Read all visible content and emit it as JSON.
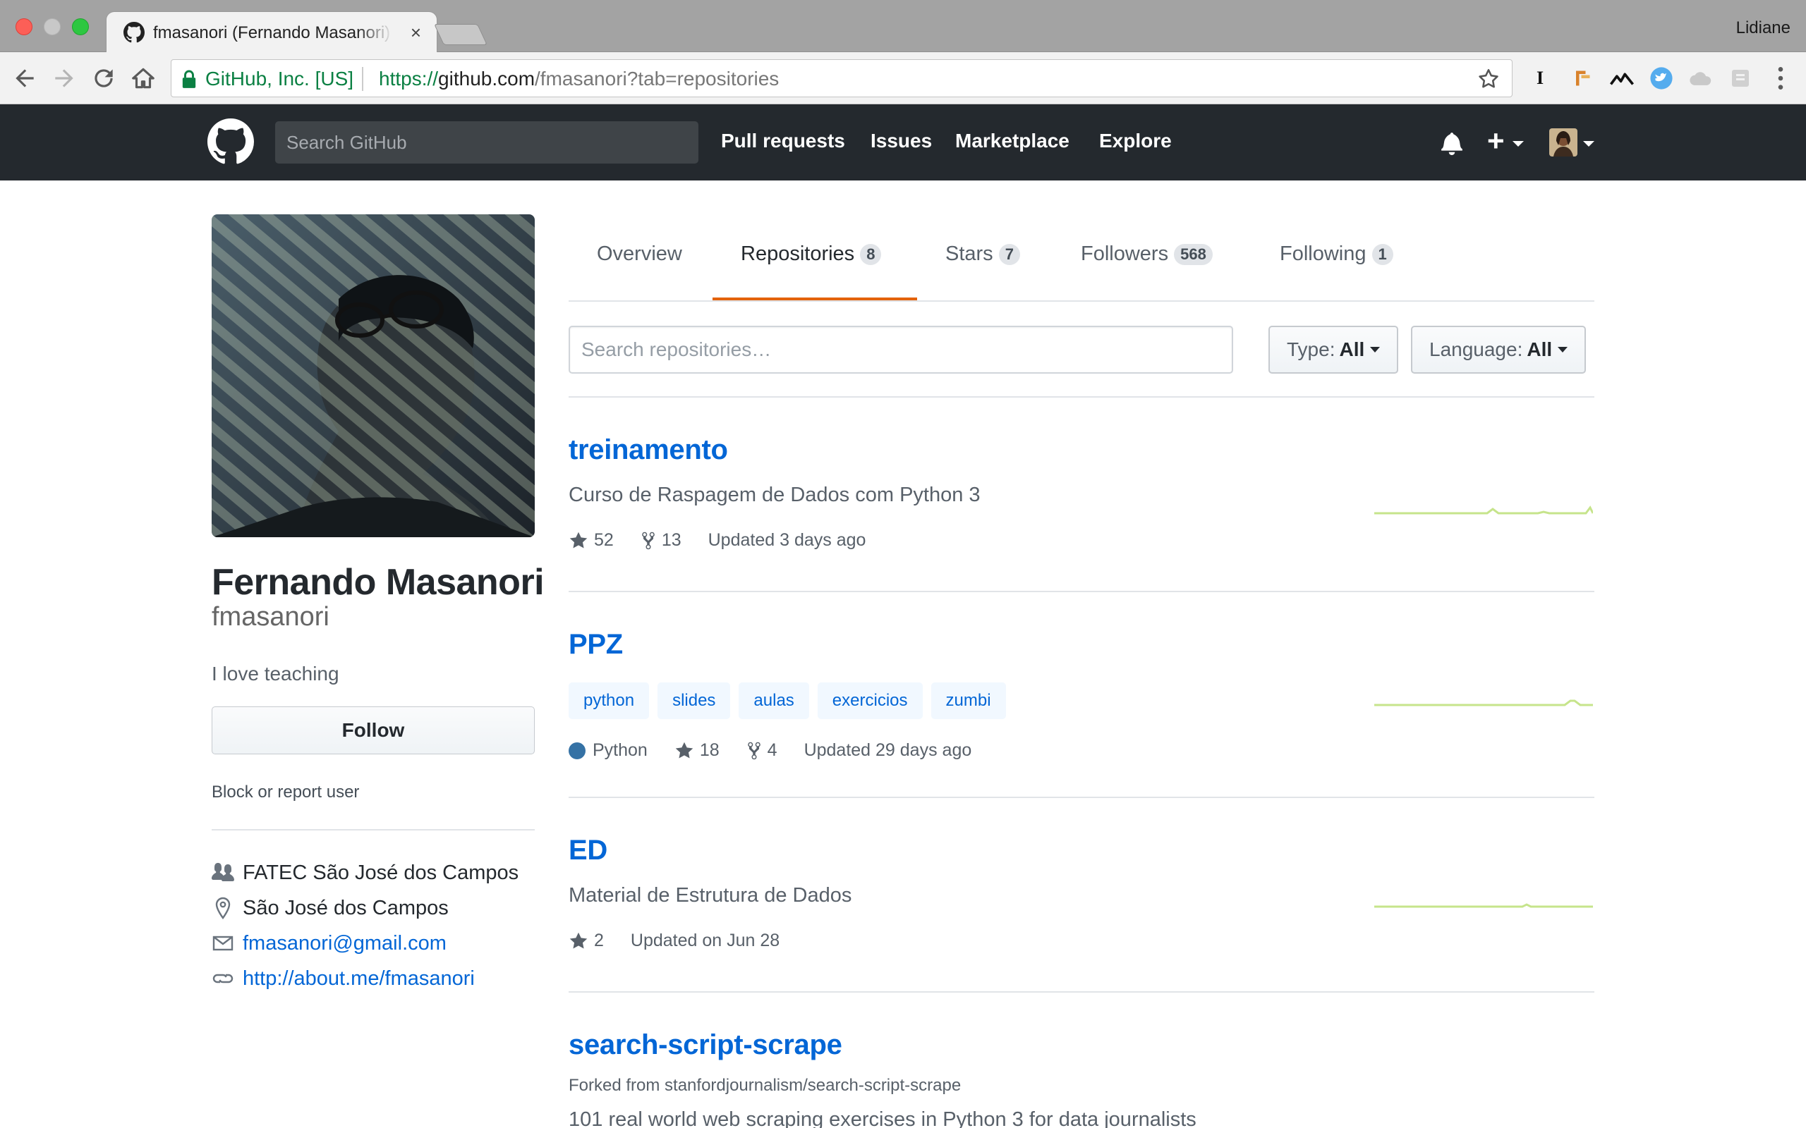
{
  "browser": {
    "tab_title": "fmasanori (Fernando Masanori)",
    "tab_close": "×",
    "profile_name": "Lidiane",
    "ev_label": "GitHub, Inc. [US]",
    "url_scheme": "https://",
    "url_host": "github.com",
    "url_path": "/fmasanori?tab=repositories",
    "extension_icons": [
      "instapaper-icon",
      "bookmark-ribbon-icon",
      "mountains-icon",
      "twitter-icon",
      "cloud-icon",
      "page-icon"
    ],
    "ext_instapaper_label": "I"
  },
  "github_header": {
    "search_placeholder": "Search GitHub",
    "nav": {
      "pull_requests": "Pull requests",
      "issues": "Issues",
      "marketplace": "Marketplace",
      "explore": "Explore"
    },
    "plus_label": "+"
  },
  "profile": {
    "full_name": "Fernando Masanori",
    "username": "fmasanori",
    "bio": "I love teaching",
    "follow_label": "Follow",
    "block_label": "Block or report user",
    "organization": "FATEC São José dos Campos",
    "location": "São José dos Campos",
    "email": "fmasanori@gmail.com",
    "website": "http://about.me/fmasanori"
  },
  "tabs": {
    "overview": "Overview",
    "repositories": "Repositories",
    "repositories_count": "8",
    "stars": "Stars",
    "stars_count": "7",
    "followers": "Followers",
    "followers_count": "568",
    "following": "Following",
    "following_count": "1"
  },
  "filters": {
    "search_placeholder": "Search repositories…",
    "type_label": "Type:",
    "type_value": "All",
    "language_label": "Language:",
    "language_value": "All"
  },
  "repos": [
    {
      "name": "treinamento",
      "description": "Curso de Raspagem de Dados com Python 3",
      "stars": "52",
      "forks": "13",
      "updated": "Updated 3 days ago"
    },
    {
      "name": "PPZ",
      "topics": [
        "python",
        "slides",
        "aulas",
        "exercicios",
        "zumbi"
      ],
      "language": "Python",
      "language_color": "#3572A5",
      "stars": "18",
      "forks": "4",
      "updated": "Updated 29 days ago"
    },
    {
      "name": "ED",
      "description": "Material de Estrutura de Dados",
      "stars": "2",
      "updated": "Updated on Jun 28"
    },
    {
      "name": "search-script-scrape",
      "forked_from": "Forked from stanfordjournalism/search-script-scrape",
      "description": "101 real world web scraping exercises in Python 3 for data journalists"
    }
  ],
  "colors": {
    "header_bg": "#24292e",
    "link": "#0366d6",
    "tab_underline": "#e36209",
    "sparkline": "#c6e48b"
  }
}
